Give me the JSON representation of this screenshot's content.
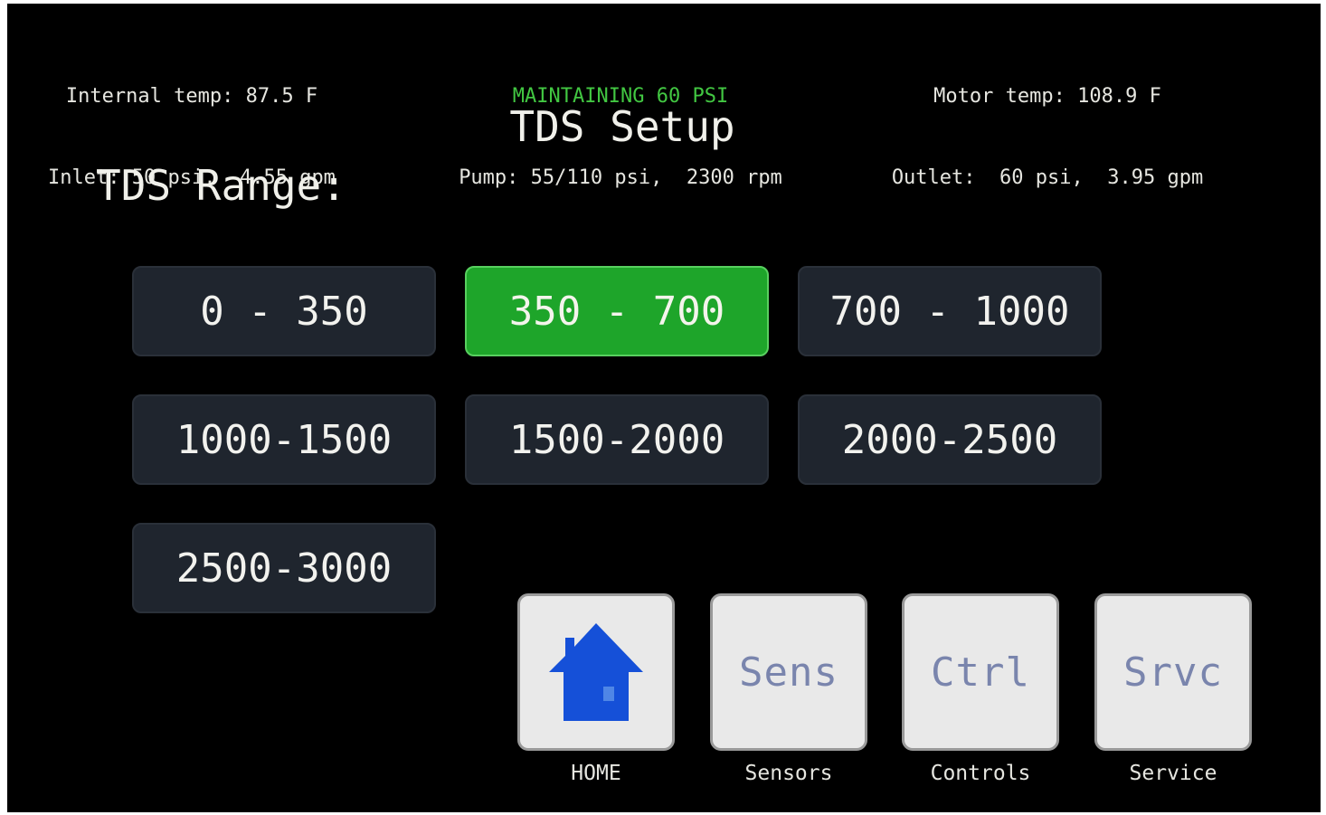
{
  "status": {
    "left": {
      "line1": "Internal temp: 87.5 F",
      "line2": "Inlet: 50 psi,  4.55 gpm"
    },
    "center": {
      "line1": "MAINTAINING 60 PSI",
      "line2": "Pump: 55/110 psi,  2300 rpm"
    },
    "right": {
      "line1": "Motor temp: 108.9 F",
      "line2": "Outlet:  60 psi,  3.95 gpm"
    }
  },
  "page": {
    "title": "TDS Setup",
    "section_label": "TDS Range:"
  },
  "ranges": [
    {
      "label": "0 - 350",
      "selected": false
    },
    {
      "label": "350 - 700",
      "selected": true
    },
    {
      "label": "700 - 1000",
      "selected": false
    },
    {
      "label": "1000-1500",
      "selected": false
    },
    {
      "label": "1500-2000",
      "selected": false
    },
    {
      "label": "2000-2500",
      "selected": false
    },
    {
      "label": "2500-3000",
      "selected": false
    }
  ],
  "nav": [
    {
      "icon": "house-icon",
      "caption": "HOME"
    },
    {
      "button_text": "Sens",
      "caption": "Sensors"
    },
    {
      "button_text": "Ctrl",
      "caption": "Controls"
    },
    {
      "button_text": "Srvc",
      "caption": "Service"
    }
  ],
  "colors": {
    "background": "#000000",
    "text": "#e9e9e3",
    "status_ok": "#42c742",
    "button_bg": "#1f252e",
    "selected_bg": "#1ea52a",
    "nav_bg": "#e9e9e9",
    "nav_text": "#7a85ad",
    "home_icon": "#1550d8"
  }
}
